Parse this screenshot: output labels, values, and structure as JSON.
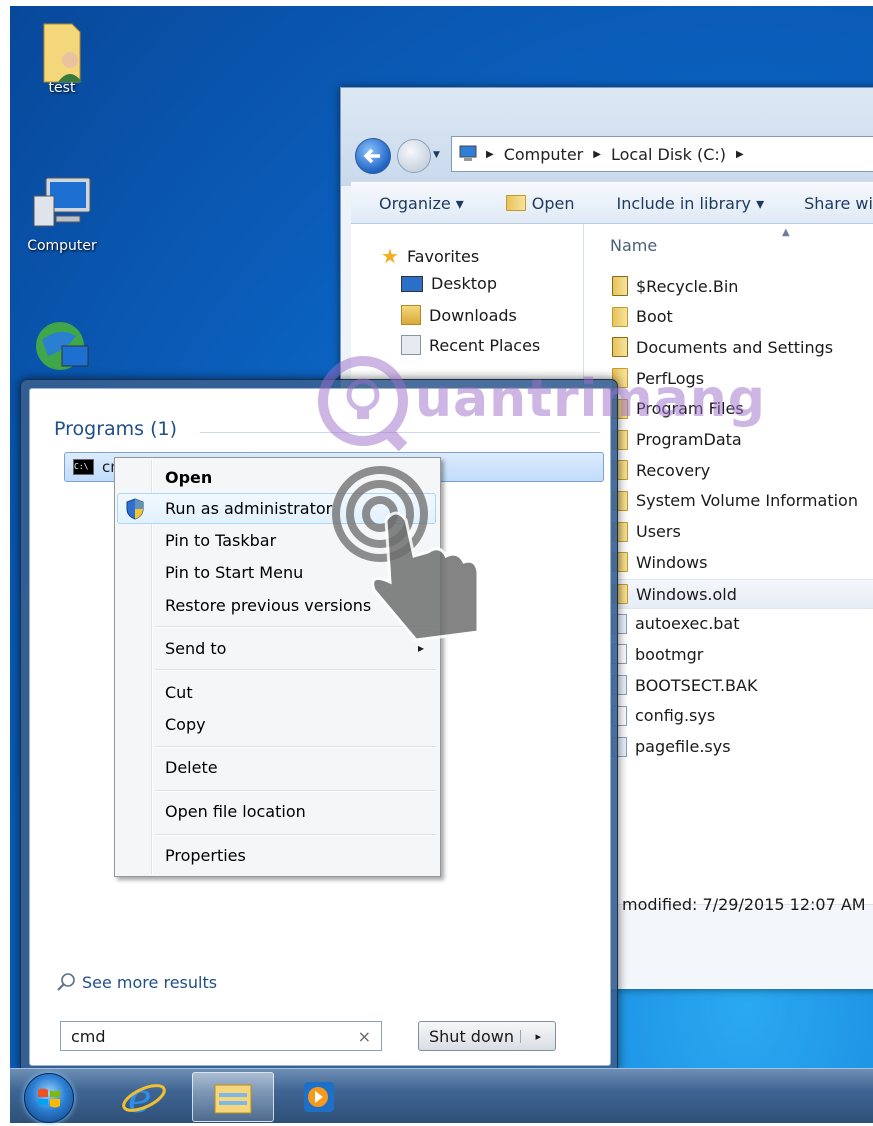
{
  "desktop": {
    "icons": [
      {
        "label": "test",
        "icon": "user-folder-icon"
      },
      {
        "label": "Computer",
        "icon": "computer-icon"
      },
      {
        "label": "",
        "icon": "network-globe-icon"
      }
    ]
  },
  "explorer": {
    "breadcrumb": [
      "Computer",
      "Local Disk (C:)"
    ],
    "toolbar": {
      "organize": "Organize ▾",
      "open": "Open",
      "include": "Include in library ▾",
      "share": "Share wi"
    },
    "nav": {
      "favorites": "Favorites",
      "items": [
        "Desktop",
        "Downloads",
        "Recent Places"
      ]
    },
    "column_header": "Name",
    "files": [
      {
        "name": "$Recycle.Bin",
        "type": "locked-folder"
      },
      {
        "name": "Boot",
        "type": "folder"
      },
      {
        "name": "Documents and Settings",
        "type": "locked-folder"
      },
      {
        "name": "PerfLogs",
        "type": "folder"
      },
      {
        "name": "Program Files",
        "type": "folder"
      },
      {
        "name": "ProgramData",
        "type": "folder"
      },
      {
        "name": "Recovery",
        "type": "folder"
      },
      {
        "name": "System Volume Information",
        "type": "folder"
      },
      {
        "name": "Users",
        "type": "folder"
      },
      {
        "name": "Windows",
        "type": "folder"
      },
      {
        "name": "Windows.old",
        "type": "folder",
        "selected": true
      },
      {
        "name": "autoexec.bat",
        "type": "file"
      },
      {
        "name": "bootmgr",
        "type": "file"
      },
      {
        "name": "BOOTSECT.BAK",
        "type": "file"
      },
      {
        "name": "config.sys",
        "type": "file"
      },
      {
        "name": "pagefile.sys",
        "type": "file"
      }
    ],
    "details": "modified: 7/29/2015 12:07 AM"
  },
  "start_menu": {
    "programs_header": "Programs (1)",
    "result_label": "cm",
    "see_more": "See more results",
    "search_value": "cmd",
    "search_clear": "×",
    "shutdown": "Shut down",
    "shutdown_arrow": "▸"
  },
  "context_menu": {
    "open": "Open",
    "run_as_admin": "Run as administrator",
    "pin_taskbar": "Pin to Taskbar",
    "pin_start": "Pin to Start Menu",
    "restore": "Restore previous versions",
    "send_to": "Send to",
    "send_to_arrow": "▸",
    "cut": "Cut",
    "copy": "Copy",
    "delete": "Delete",
    "open_location": "Open file location",
    "properties": "Properties"
  },
  "watermark": {
    "text": "uantrimang"
  },
  "colors": {
    "desktop_blue": "#0a5cb8",
    "hover_blue": "#e2f1fc",
    "link_blue": "#1e4f8a",
    "folder_yellow": "#f7e39c"
  }
}
